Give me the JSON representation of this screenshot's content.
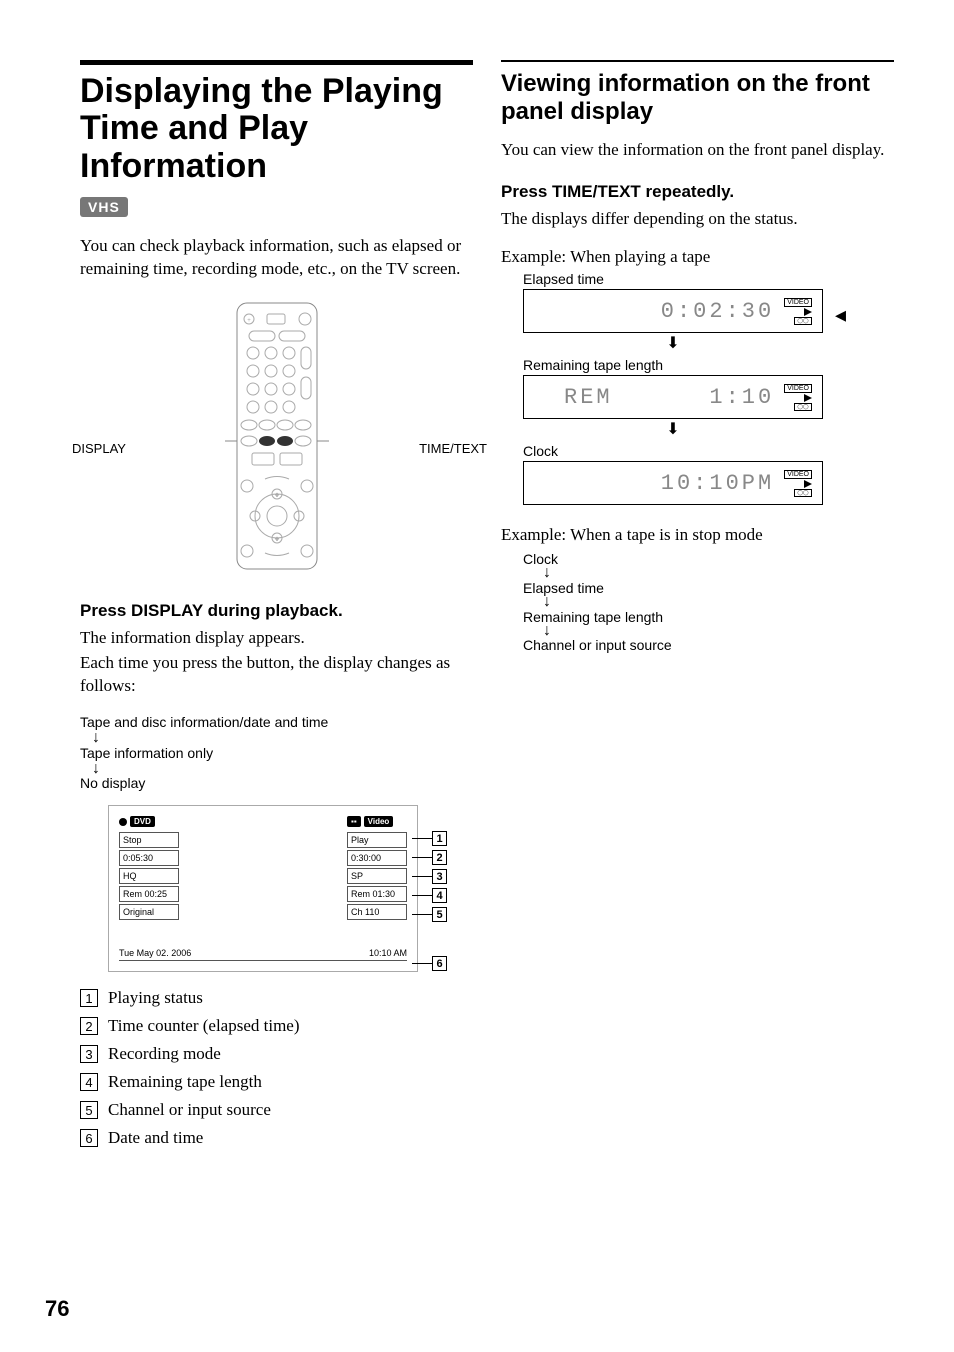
{
  "page_number": "76",
  "left": {
    "title": "Displaying the Playing Time and Play Information",
    "badge": "VHS",
    "intro": "You can check playback information, such as elapsed or remaining time, recording mode, etc., on the TV screen.",
    "remote_labels": {
      "display": "DISPLAY",
      "timetext": "TIME/TEXT"
    },
    "press_heading": "Press DISPLAY during playback.",
    "press_body1": "The information display appears.",
    "press_body2": "Each time you press the button, the display changes as follows:",
    "flow": [
      "Tape and disc information/date and time",
      "Tape information only",
      "No display"
    ],
    "osd": {
      "dvd_tag": "DVD",
      "video_tag": "Video",
      "left_cells": [
        "Stop",
        "0:05:30",
        "HQ",
        "Rem 00:25",
        "Original"
      ],
      "right_cells": [
        "Play",
        "0:30:00",
        "SP",
        "Rem 01:30",
        "Ch 110"
      ],
      "footer_date": "Tue May 02. 2006",
      "footer_time": "10:10 AM"
    },
    "legend": [
      "Playing status",
      "Time counter (elapsed time)",
      "Recording mode",
      "Remaining tape length",
      "Channel or input source",
      "Date and time"
    ]
  },
  "right": {
    "title": "Viewing information on the front panel display",
    "intro": "You can view the information on the front panel display.",
    "press_heading": "Press TIME/TEXT repeatedly.",
    "press_body": "The displays differ depending on the status.",
    "example1": "Example: When playing a tape",
    "labels": {
      "elapsed": "Elapsed time",
      "remaining": "Remaining tape length",
      "clock": "Clock"
    },
    "displays": {
      "elapsed": "0:02:30",
      "remaining_left": "REM",
      "remaining_right": "1:10",
      "clock": "10:10PM",
      "video_badge": "VIDEO"
    },
    "example2": "Example: When a tape is in stop mode",
    "stop_flow": [
      "Clock",
      "Elapsed time",
      "Remaining tape length",
      "Channel or input source"
    ]
  }
}
